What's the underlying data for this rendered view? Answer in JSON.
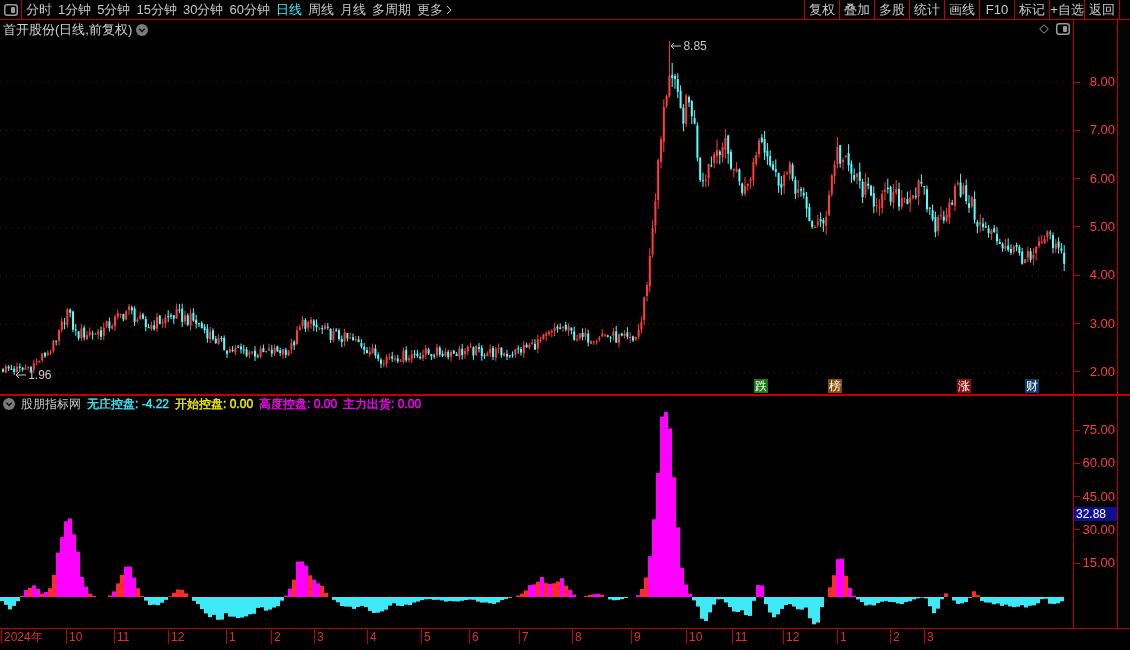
{
  "toolbar": {
    "periods": [
      {
        "label": "分时",
        "selected": false
      },
      {
        "label": "1分钟",
        "selected": false
      },
      {
        "label": "5分钟",
        "selected": false
      },
      {
        "label": "15分钟",
        "selected": false
      },
      {
        "label": "30分钟",
        "selected": false
      },
      {
        "label": "60分钟",
        "selected": false
      },
      {
        "label": "日线",
        "selected": true
      },
      {
        "label": "周线",
        "selected": false
      },
      {
        "label": "月线",
        "selected": false
      },
      {
        "label": "多周期",
        "selected": false
      }
    ],
    "more": "更多",
    "actions": [
      "复权",
      "叠加",
      "多股",
      "统计",
      "画线",
      "F10",
      "标记",
      "+自选",
      "返回"
    ]
  },
  "price_chart": {
    "title": "首开股份(日线,前复权)",
    "high_label": "8.85",
    "low_label": "1.96",
    "markers": [
      {
        "label": "跌",
        "color": "#167a16"
      },
      {
        "label": "榜",
        "color": "#8c4a0c"
      },
      {
        "label": "涨",
        "color": "#8a0c0c"
      },
      {
        "label": "财",
        "color": "#0c3c6e"
      }
    ],
    "axis_labels": [
      "8.00",
      "7.00",
      "6.00",
      "5.00",
      "4.00",
      "3.00",
      "2.00"
    ]
  },
  "indicator": {
    "name": "股朋指标网",
    "readings": [
      {
        "text": "无庄控盘: -4.22",
        "color": "#3ee8f4"
      },
      {
        "text": "开始控盘: 0.00",
        "color": "#f0f000"
      },
      {
        "text": "高度控盘: 0.00",
        "color": "#ff00ff"
      },
      {
        "text": "主力出货: 0.00",
        "color": "#ff00ff"
      }
    ],
    "axis_labels": [
      "75.00",
      "60.00",
      "45.00",
      "30.00",
      "15.00"
    ],
    "current_value": "32.88"
  },
  "date_axis": [
    "2024年",
    "10",
    "11",
    "12",
    "1",
    "2",
    "3",
    "4",
    "5",
    "6",
    "7",
    "8",
    "9",
    "10",
    "11",
    "12",
    "1",
    "2",
    "3"
  ]
}
